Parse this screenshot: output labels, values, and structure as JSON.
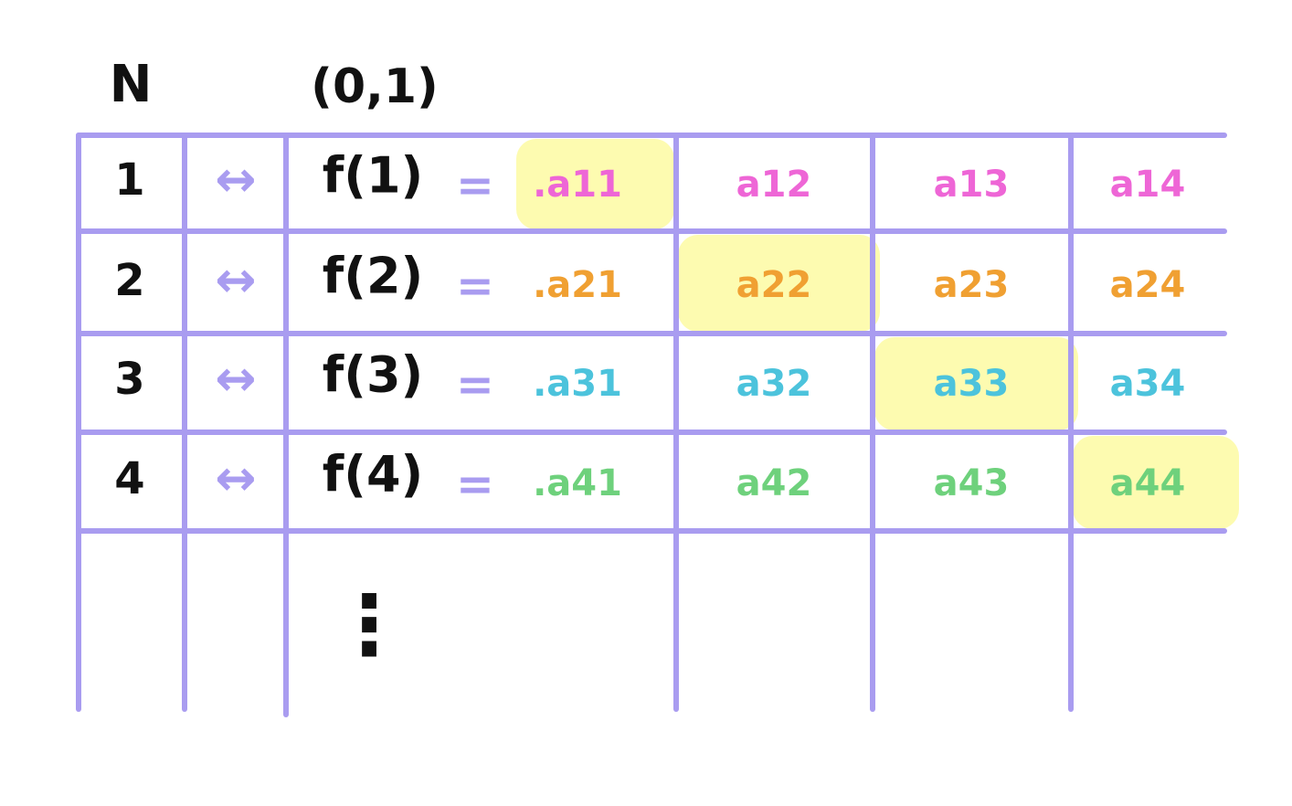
{
  "colors": {
    "grid": "#a99cf0",
    "ink": "#111111",
    "highlight": "#fdfbb0",
    "arrow": "#a99cf0",
    "equals": "#a99cf0",
    "row1": "#ee66d6",
    "row2": "#f0a032",
    "row3": "#4cc3dc",
    "row4": "#6ed17c"
  },
  "headers": {
    "n": "N",
    "interval": "(0,1)"
  },
  "arrow_glyph": "↔",
  "equals_glyph": "=",
  "rows": [
    {
      "n": "1",
      "f": "f(1)",
      "digits": [
        ".a11",
        "a12",
        "a13",
        "a14"
      ],
      "color": "row1",
      "diag": 0
    },
    {
      "n": "2",
      "f": "f(2)",
      "digits": [
        ".a21",
        "a22",
        "a23",
        "a24"
      ],
      "color": "row2",
      "diag": 1
    },
    {
      "n": "3",
      "f": "f(3)",
      "digits": [
        ".a31",
        "a32",
        "a33",
        "a34"
      ],
      "color": "row3",
      "diag": 2
    },
    {
      "n": "4",
      "f": "f(4)",
      "digits": [
        ".a41",
        "a42",
        "a43",
        "a44"
      ],
      "color": "row4",
      "diag": 3
    }
  ],
  "ellipsis": "⋮"
}
